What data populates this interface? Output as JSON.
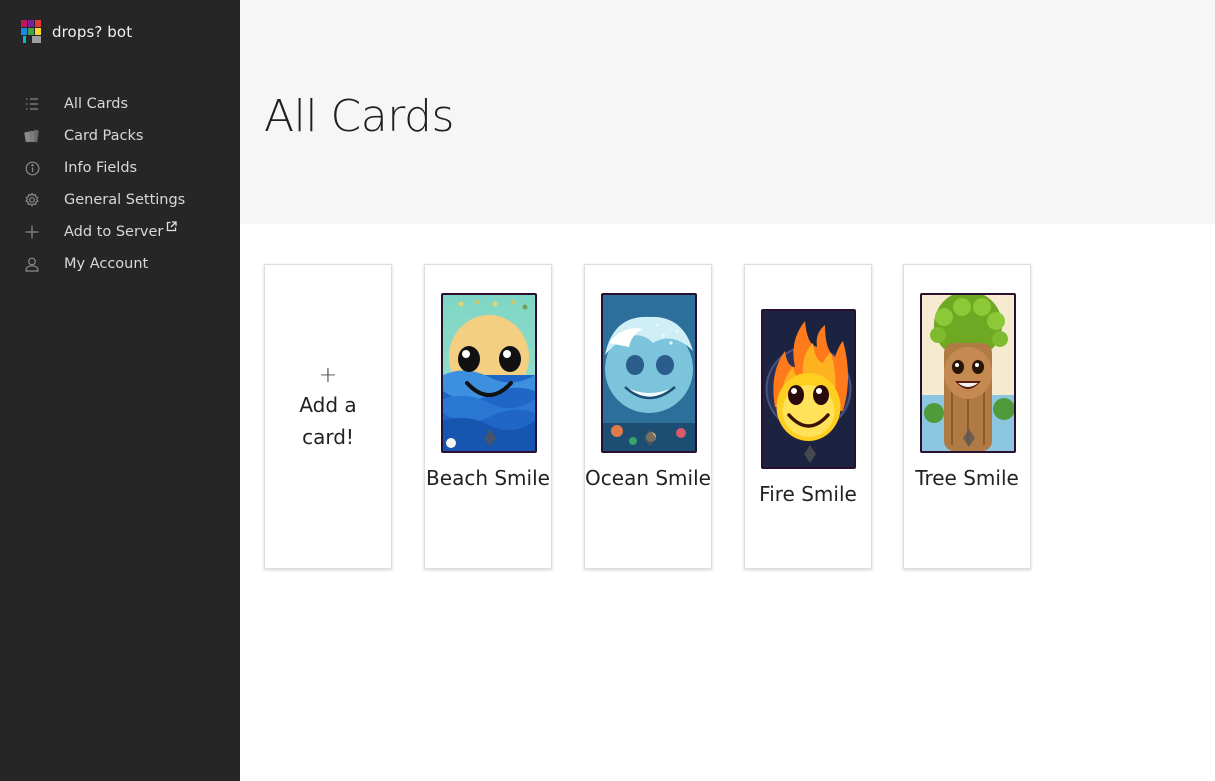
{
  "brand": {
    "name": "drops? bot",
    "logo_icon": "bot-logo-icon"
  },
  "nav": {
    "items": [
      {
        "label": "All Cards",
        "icon": "list-icon"
      },
      {
        "label": "Card Packs",
        "icon": "card-packs-icon"
      },
      {
        "label": "Info Fields",
        "icon": "info-icon"
      },
      {
        "label": "General Settings",
        "icon": "gear-icon"
      },
      {
        "label": "Add to Server",
        "icon": "plus-icon",
        "external_icon": "external-link-icon"
      },
      {
        "label": "My Account",
        "icon": "user-icon"
      }
    ]
  },
  "page": {
    "title": "All Cards"
  },
  "cards": {
    "add": {
      "plus": "+",
      "label": "Add a card!"
    },
    "items": [
      {
        "name": "Beach Smile",
        "art": "beach-smile-art"
      },
      {
        "name": "Ocean Smile",
        "art": "ocean-smile-art"
      },
      {
        "name": "Fire Smile",
        "art": "fire-smile-art"
      },
      {
        "name": "Tree Smile",
        "art": "tree-smile-art"
      }
    ]
  },
  "colors": {
    "sidebar_bg": "#262626",
    "header_bg": "#f6f6f6",
    "card_frame": "#2a1030"
  }
}
